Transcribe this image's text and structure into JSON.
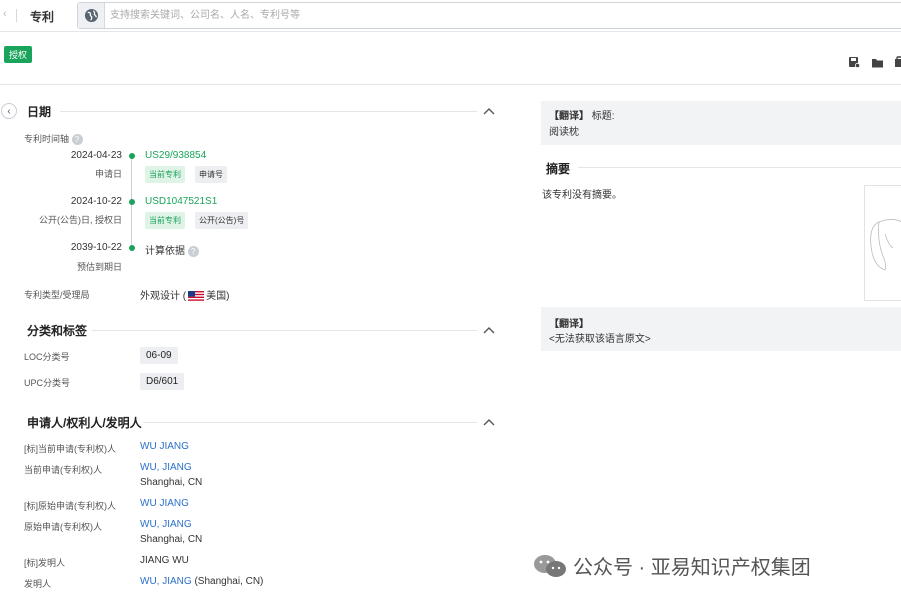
{
  "topbar": {
    "section_label": "专利",
    "search_placeholder": "支持搜索关键词、公司名、人名、专利号等"
  },
  "status": {
    "badge": "授权"
  },
  "toolbar_icons": [
    "save-icon",
    "folder-icon",
    "copy-icon"
  ],
  "dates_section": {
    "title": "日期",
    "timeline_label": "专利时间轴",
    "timeline": [
      {
        "date": "2024-04-23",
        "sub": "申请日",
        "number": "US29/938854",
        "tags": [
          "当前专利",
          "申请号"
        ]
      },
      {
        "date": "2024-10-22",
        "sub": "公开(公告)日, 授权日",
        "number": "USD1047521S1",
        "tags": [
          "当前专利",
          "公开(公告)号"
        ]
      },
      {
        "date": "2039-10-22",
        "sub": "预估到期日",
        "text": "计算依据"
      }
    ],
    "type_label": "专利类型/受理局",
    "type_value": "外观设计 (",
    "country": "美国)"
  },
  "classification_section": {
    "title": "分类和标签",
    "rows": [
      {
        "label": "LOC分类号",
        "value": "06-09"
      },
      {
        "label": "UPC分类号",
        "value": "D6/601"
      }
    ]
  },
  "parties_section": {
    "title": "申请人/权利人/发明人",
    "rows": [
      {
        "label": "[标]当前申请(专利权)人",
        "value": "WU JIANG"
      },
      {
        "label": "当前申请(专利权)人",
        "value": "WU, JIANG",
        "location": "Shanghai, CN"
      },
      {
        "label": "[标]原始申请(专利权)人",
        "value": "WU JIANG"
      },
      {
        "label": "原始申请(专利权)人",
        "value": "WU, JIANG",
        "location": "Shanghai, CN"
      },
      {
        "label": "[标]发明人",
        "value": "JIANG WU"
      },
      {
        "label": "发明人",
        "value": "WU, JIANG",
        "location_inline": " (Shanghai, CN)"
      }
    ]
  },
  "right_panel": {
    "translate_tag": "【翻译】",
    "title_label": " 标题:",
    "title_value": "阅读枕",
    "abstract_title": "摘要",
    "abstract_text": "该专利没有摘要。",
    "translate_tag2": "【翻译】",
    "no_source": "<无法获取该语言原文>"
  },
  "watermark": "公众号 · 亚易知识产权集团",
  "colors": {
    "accent_green": "#1aa35a",
    "link_blue": "#2a6fc9"
  }
}
